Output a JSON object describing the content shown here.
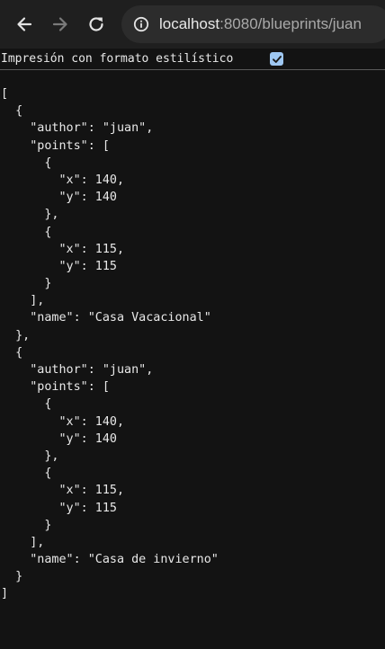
{
  "browser": {
    "url_host": "localhost",
    "url_rest": ":8080/blueprints/juan",
    "back_icon": "arrow-left-icon",
    "forward_icon": "arrow-right-icon",
    "reload_icon": "reload-icon",
    "info_icon": "info-circle-icon"
  },
  "pretty_print": {
    "label": "Impresión con formato estilístico",
    "checked": true
  },
  "json_lines": [
    "[",
    "  {",
    "    \"author\": \"juan\",",
    "    \"points\": [",
    "      {",
    "        \"x\": 140,",
    "        \"y\": 140",
    "      },",
    "      {",
    "        \"x\": 115,",
    "        \"y\": 115",
    "      }",
    "    ],",
    "    \"name\": \"Casa Vacacional\"",
    "  },",
    "  {",
    "    \"author\": \"juan\",",
    "    \"points\": [",
    "      {",
    "        \"x\": 140,",
    "        \"y\": 140",
    "      },",
    "      {",
    "        \"x\": 115,",
    "        \"y\": 115",
    "      }",
    "    ],",
    "    \"name\": \"Casa de invierno\"",
    "  }",
    "]"
  ],
  "colors": {
    "toolbar_bg": "#1f1f1f",
    "page_bg": "#131313",
    "text": "#e8e8e8",
    "checkbox_accent": "#9ec7f2"
  }
}
